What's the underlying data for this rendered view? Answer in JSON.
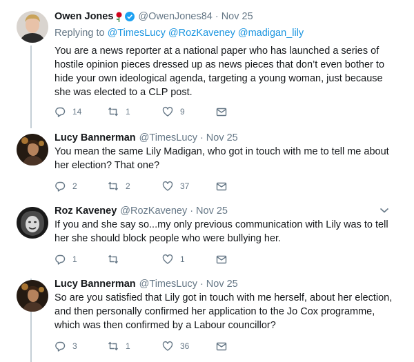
{
  "tweets": [
    {
      "name": "Owen Jones",
      "handle": "@OwenJones84",
      "sep": "·",
      "date": "Nov 25",
      "replying_prefix": "Replying to",
      "replying_to": "@TimesLucy @RozKaveney @madigan_lily",
      "text": "You are a news reporter at a national paper who has launched a series of hostile opinion pieces dressed up as news pieces that don’t even bother to hide your own ideological agenda, targeting a young woman, just because she was elected to a CLP post.",
      "replies": "14",
      "retweets": "1",
      "likes": "9"
    },
    {
      "name": "Lucy Bannerman",
      "handle": "@TimesLucy",
      "sep": "·",
      "date": "Nov 25",
      "text": "You mean the same Lily Madigan, who got in touch with me to tell me about her election? That one?",
      "replies": "2",
      "retweets": "2",
      "likes": "37"
    },
    {
      "name": "Roz Kaveney",
      "handle": "@RozKaveney",
      "sep": "·",
      "date": "Nov 25",
      "text": "If you and she say so...my only previous communication with Lily was to tell her she should block people who were bullying her.",
      "replies": "1",
      "retweets": "",
      "likes": "1"
    },
    {
      "name": "Lucy Bannerman",
      "handle": "@TimesLucy",
      "sep": "·",
      "date": "Nov 25",
      "text": "So are you satisfied that Lily got in touch with me herself, about her election, and then personally confirmed her application to the Jo Cox programme, which was then confirmed by a Labour councillor?",
      "replies": "3",
      "retweets": "1",
      "likes": "36"
    }
  ],
  "icons": {
    "reply": "reply-icon",
    "retweet": "retweet-icon",
    "like": "heart-icon",
    "dm": "envelope-icon",
    "more": "chevron-down-icon",
    "verified": "verified-badge-icon",
    "rose": "rose-icon"
  },
  "colors": {
    "link": "#1b95e0",
    "secondary": "#657786",
    "thread_line": "#c4cfd6",
    "verified": "#1da1f2",
    "rose": "#d0021b"
  }
}
